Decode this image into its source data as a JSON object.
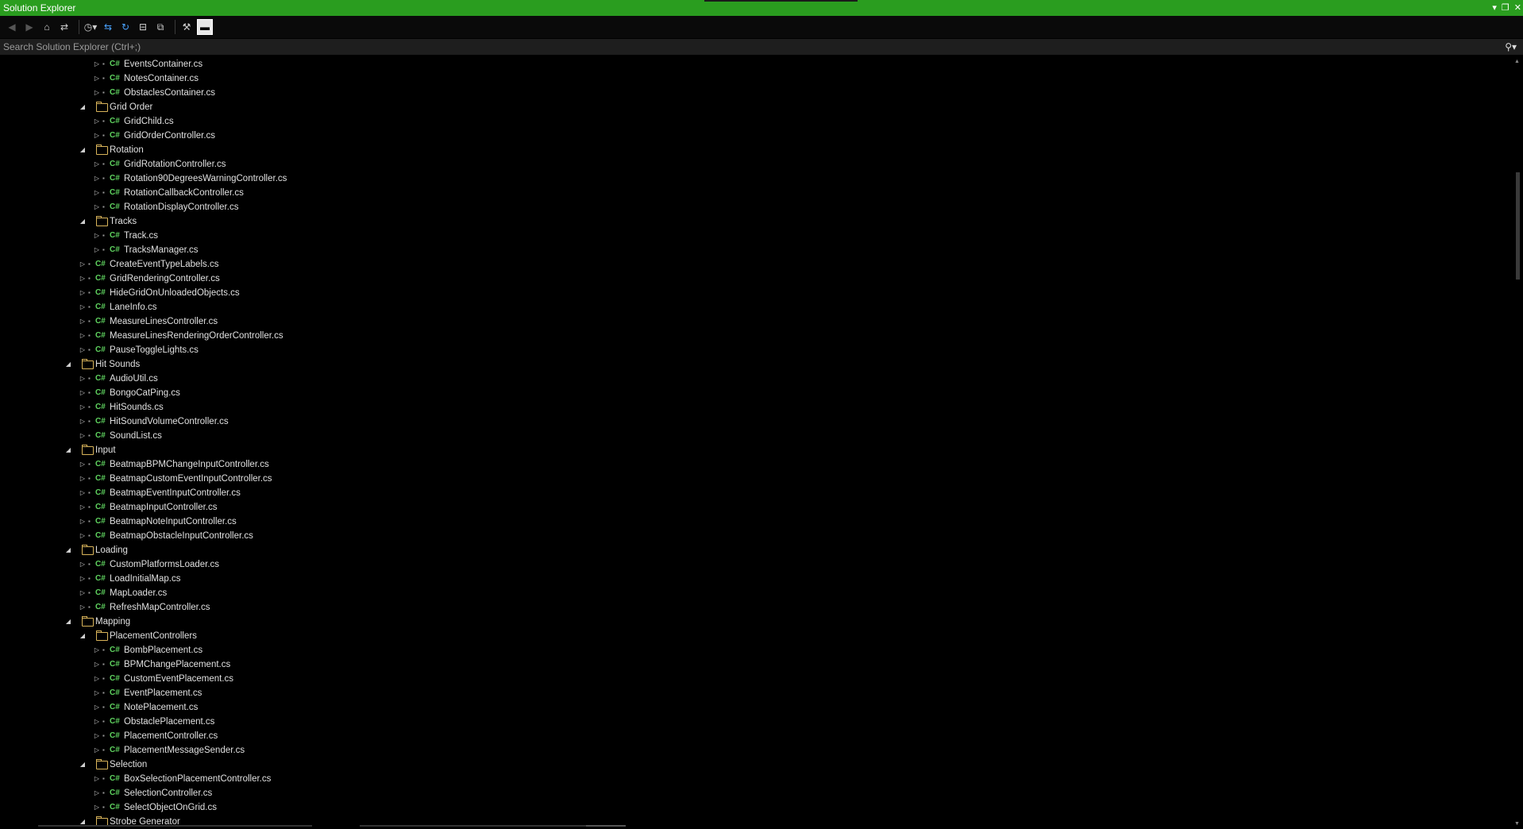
{
  "window": {
    "title": "Solution Explorer",
    "controls": {
      "dropdown": "▾",
      "restore": "❐",
      "close": "✕"
    }
  },
  "toolbar": {
    "icons": [
      "back-icon",
      "forward-icon",
      "home-icon",
      "switch-views-icon",
      "pending-changes-filter-icon",
      "sync-icon",
      "refresh-icon",
      "collapse-all-icon",
      "show-all-files-icon",
      "properties-icon",
      "preview-icon"
    ]
  },
  "search": {
    "placeholder": "Search Solution Explorer (Ctrl+;)"
  },
  "tree": [
    {
      "level": 3,
      "kind": "file",
      "label": "EventsContainer.cs"
    },
    {
      "level": 3,
      "kind": "file",
      "label": "NotesContainer.cs"
    },
    {
      "level": 3,
      "kind": "file",
      "label": "ObstaclesContainer.cs"
    },
    {
      "level": 2,
      "kind": "folder",
      "label": "Grid Order"
    },
    {
      "level": 3,
      "kind": "file",
      "label": "GridChild.cs"
    },
    {
      "level": 3,
      "kind": "file",
      "label": "GridOrderController.cs"
    },
    {
      "level": 2,
      "kind": "folder",
      "label": "Rotation"
    },
    {
      "level": 3,
      "kind": "file",
      "label": "GridRotationController.cs"
    },
    {
      "level": 3,
      "kind": "file",
      "label": "Rotation90DegreesWarningController.cs"
    },
    {
      "level": 3,
      "kind": "file",
      "label": "RotationCallbackController.cs"
    },
    {
      "level": 3,
      "kind": "file",
      "label": "RotationDisplayController.cs"
    },
    {
      "level": 2,
      "kind": "folder",
      "label": "Tracks"
    },
    {
      "level": 3,
      "kind": "file",
      "label": "Track.cs"
    },
    {
      "level": 3,
      "kind": "file",
      "label": "TracksManager.cs"
    },
    {
      "level": 2,
      "kind": "file",
      "label": "CreateEventTypeLabels.cs"
    },
    {
      "level": 2,
      "kind": "file",
      "label": "GridRenderingController.cs"
    },
    {
      "level": 2,
      "kind": "file",
      "label": "HideGridOnUnloadedObjects.cs"
    },
    {
      "level": 2,
      "kind": "file",
      "label": "LaneInfo.cs"
    },
    {
      "level": 2,
      "kind": "file",
      "label": "MeasureLinesController.cs"
    },
    {
      "level": 2,
      "kind": "file",
      "label": "MeasureLinesRenderingOrderController.cs"
    },
    {
      "level": 2,
      "kind": "file",
      "label": "PauseToggleLights.cs"
    },
    {
      "level": 1,
      "kind": "folder",
      "label": "Hit Sounds"
    },
    {
      "level": 2,
      "kind": "file",
      "label": "AudioUtil.cs"
    },
    {
      "level": 2,
      "kind": "file",
      "label": "BongoCatPing.cs"
    },
    {
      "level": 2,
      "kind": "file",
      "label": "HitSounds.cs"
    },
    {
      "level": 2,
      "kind": "file",
      "label": "HitSoundVolumeController.cs"
    },
    {
      "level": 2,
      "kind": "file",
      "label": "SoundList.cs"
    },
    {
      "level": 1,
      "kind": "folder",
      "label": "Input"
    },
    {
      "level": 2,
      "kind": "file",
      "label": "BeatmapBPMChangeInputController.cs"
    },
    {
      "level": 2,
      "kind": "file",
      "label": "BeatmapCustomEventInputController.cs"
    },
    {
      "level": 2,
      "kind": "file",
      "label": "BeatmapEventInputController.cs"
    },
    {
      "level": 2,
      "kind": "file",
      "label": "BeatmapInputController.cs"
    },
    {
      "level": 2,
      "kind": "file",
      "label": "BeatmapNoteInputController.cs"
    },
    {
      "level": 2,
      "kind": "file",
      "label": "BeatmapObstacleInputController.cs"
    },
    {
      "level": 1,
      "kind": "folder",
      "label": "Loading"
    },
    {
      "level": 2,
      "kind": "file",
      "label": "CustomPlatformsLoader.cs"
    },
    {
      "level": 2,
      "kind": "file",
      "label": "LoadInitialMap.cs"
    },
    {
      "level": 2,
      "kind": "file",
      "label": "MapLoader.cs"
    },
    {
      "level": 2,
      "kind": "file",
      "label": "RefreshMapController.cs"
    },
    {
      "level": 1,
      "kind": "folder",
      "label": "Mapping"
    },
    {
      "level": 2,
      "kind": "folder",
      "label": "PlacementControllers"
    },
    {
      "level": 3,
      "kind": "file",
      "label": "BombPlacement.cs"
    },
    {
      "level": 3,
      "kind": "file",
      "label": "BPMChangePlacement.cs"
    },
    {
      "level": 3,
      "kind": "file",
      "label": "CustomEventPlacement.cs"
    },
    {
      "level": 3,
      "kind": "file",
      "label": "EventPlacement.cs"
    },
    {
      "level": 3,
      "kind": "file",
      "label": "NotePlacement.cs"
    },
    {
      "level": 3,
      "kind": "file",
      "label": "ObstaclePlacement.cs"
    },
    {
      "level": 3,
      "kind": "file",
      "label": "PlacementController.cs"
    },
    {
      "level": 3,
      "kind": "file",
      "label": "PlacementMessageSender.cs"
    },
    {
      "level": 2,
      "kind": "folder",
      "label": "Selection"
    },
    {
      "level": 3,
      "kind": "file",
      "label": "BoxSelectionPlacementController.cs"
    },
    {
      "level": 3,
      "kind": "file",
      "label": "SelectionController.cs"
    },
    {
      "level": 3,
      "kind": "file",
      "label": "SelectObjectOnGrid.cs"
    },
    {
      "level": 2,
      "kind": "folder",
      "label": "Strobe Generator"
    }
  ],
  "glyphs": {
    "collapsed": "▷",
    "expanded": "◢",
    "lock": "🔒",
    "csharp": "C#"
  },
  "colors": {
    "titlebar": "#2a9d1f",
    "csharp": "#5fd35f",
    "folder": "#d9b45a",
    "background": "#000000"
  }
}
